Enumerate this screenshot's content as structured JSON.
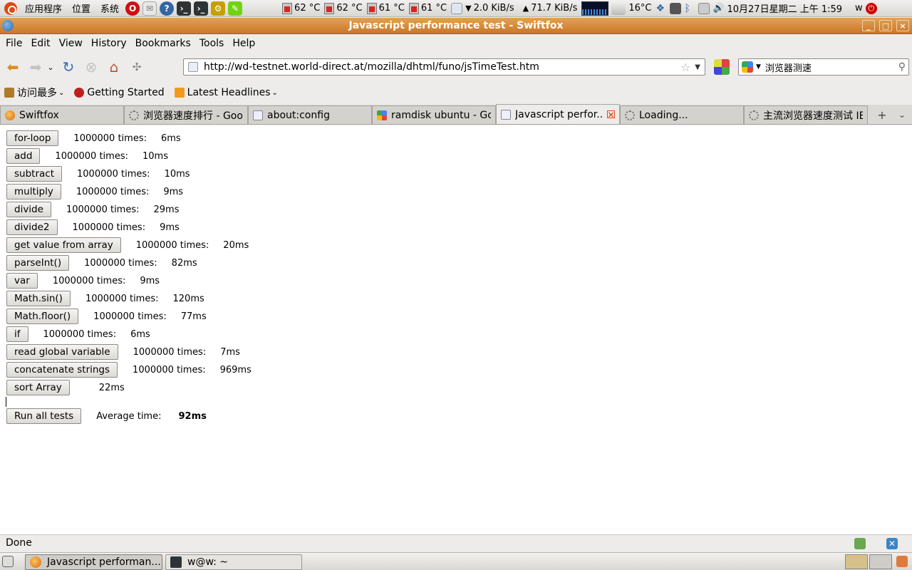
{
  "top_panel": {
    "menus": [
      "应用程序",
      "位置",
      "系统"
    ],
    "temps": [
      "62 °C",
      "62 °C",
      "61 °C",
      "61 °C"
    ],
    "net_down": "2.0 KiB/s",
    "net_up": "71.7 KiB/s",
    "weather": "16°C",
    "datetime": "10月27日星期二 上午 1:59",
    "user": "w"
  },
  "window": {
    "title": "Javascript performance test - Swiftfox",
    "buttons": [
      "_",
      "□",
      "×"
    ]
  },
  "menubar": {
    "items": [
      {
        "label": "File",
        "accel": "F"
      },
      {
        "label": "Edit",
        "accel": "E"
      },
      {
        "label": "View",
        "accel": "V"
      },
      {
        "label": "History",
        "accel": "s"
      },
      {
        "label": "Bookmarks",
        "accel": "B"
      },
      {
        "label": "Tools",
        "accel": "T"
      },
      {
        "label": "Help",
        "accel": "H"
      }
    ]
  },
  "navbar": {
    "url": "http://wd-testnet.world-direct.at/mozilla/dhtml/funo/jsTimeTest.htm",
    "search_value": "浏览器测速"
  },
  "bookmarks": {
    "items": [
      "访问最多",
      "Getting Started",
      "Latest Headlines"
    ]
  },
  "tabs": [
    {
      "label": "Swiftfox",
      "icon": "swiftfox-icon",
      "active": false
    },
    {
      "label": "浏览器速度排行 - Goo...",
      "icon": "loading-icon",
      "active": false
    },
    {
      "label": "about:config",
      "icon": "page-icon",
      "active": false
    },
    {
      "label": "ramdisk ubuntu - Go...",
      "icon": "google-icon",
      "active": false
    },
    {
      "label": "Javascript perfor...",
      "icon": "page-icon",
      "active": true
    },
    {
      "label": "Loading...",
      "icon": "loading-icon",
      "active": false
    },
    {
      "label": "主流浏览器速度测试 IE...",
      "icon": "loading-icon",
      "active": false
    }
  ],
  "tests": [
    {
      "label": "for-loop",
      "times": "1000000 times:",
      "result": "6ms"
    },
    {
      "label": "add",
      "times": "1000000 times:",
      "result": "10ms"
    },
    {
      "label": "subtract",
      "times": "1000000 times:",
      "result": "10ms"
    },
    {
      "label": "multiply",
      "times": "1000000 times:",
      "result": "9ms"
    },
    {
      "label": "divide",
      "times": "1000000 times:",
      "result": "29ms"
    },
    {
      "label": "divide2",
      "times": "1000000 times:",
      "result": "9ms"
    },
    {
      "label": "get value from array",
      "times": "1000000 times:",
      "result": "20ms"
    },
    {
      "label": "parseInt()",
      "times": "1000000 times:",
      "result": "82ms"
    },
    {
      "label": "var",
      "times": "1000000 times:",
      "result": "9ms"
    },
    {
      "label": "Math.sin()",
      "times": "1000000 times:",
      "result": "120ms"
    },
    {
      "label": "Math.floor()",
      "times": "1000000 times:",
      "result": "77ms"
    },
    {
      "label": "if",
      "times": "1000000 times:",
      "result": "6ms"
    },
    {
      "label": "read global variable",
      "times": "1000000 times:",
      "result": "7ms"
    },
    {
      "label": "concatenate strings",
      "times": "1000000 times:",
      "result": "969ms"
    },
    {
      "label": "sort Array",
      "times": "",
      "result": "22ms"
    }
  ],
  "summary": {
    "run_all_label": "Run all tests",
    "average_label": "Average time:",
    "average_value": "92ms"
  },
  "status": {
    "text": "Done"
  },
  "taskbar": {
    "items": [
      "Javascript performan...",
      "w@w: ~"
    ]
  }
}
